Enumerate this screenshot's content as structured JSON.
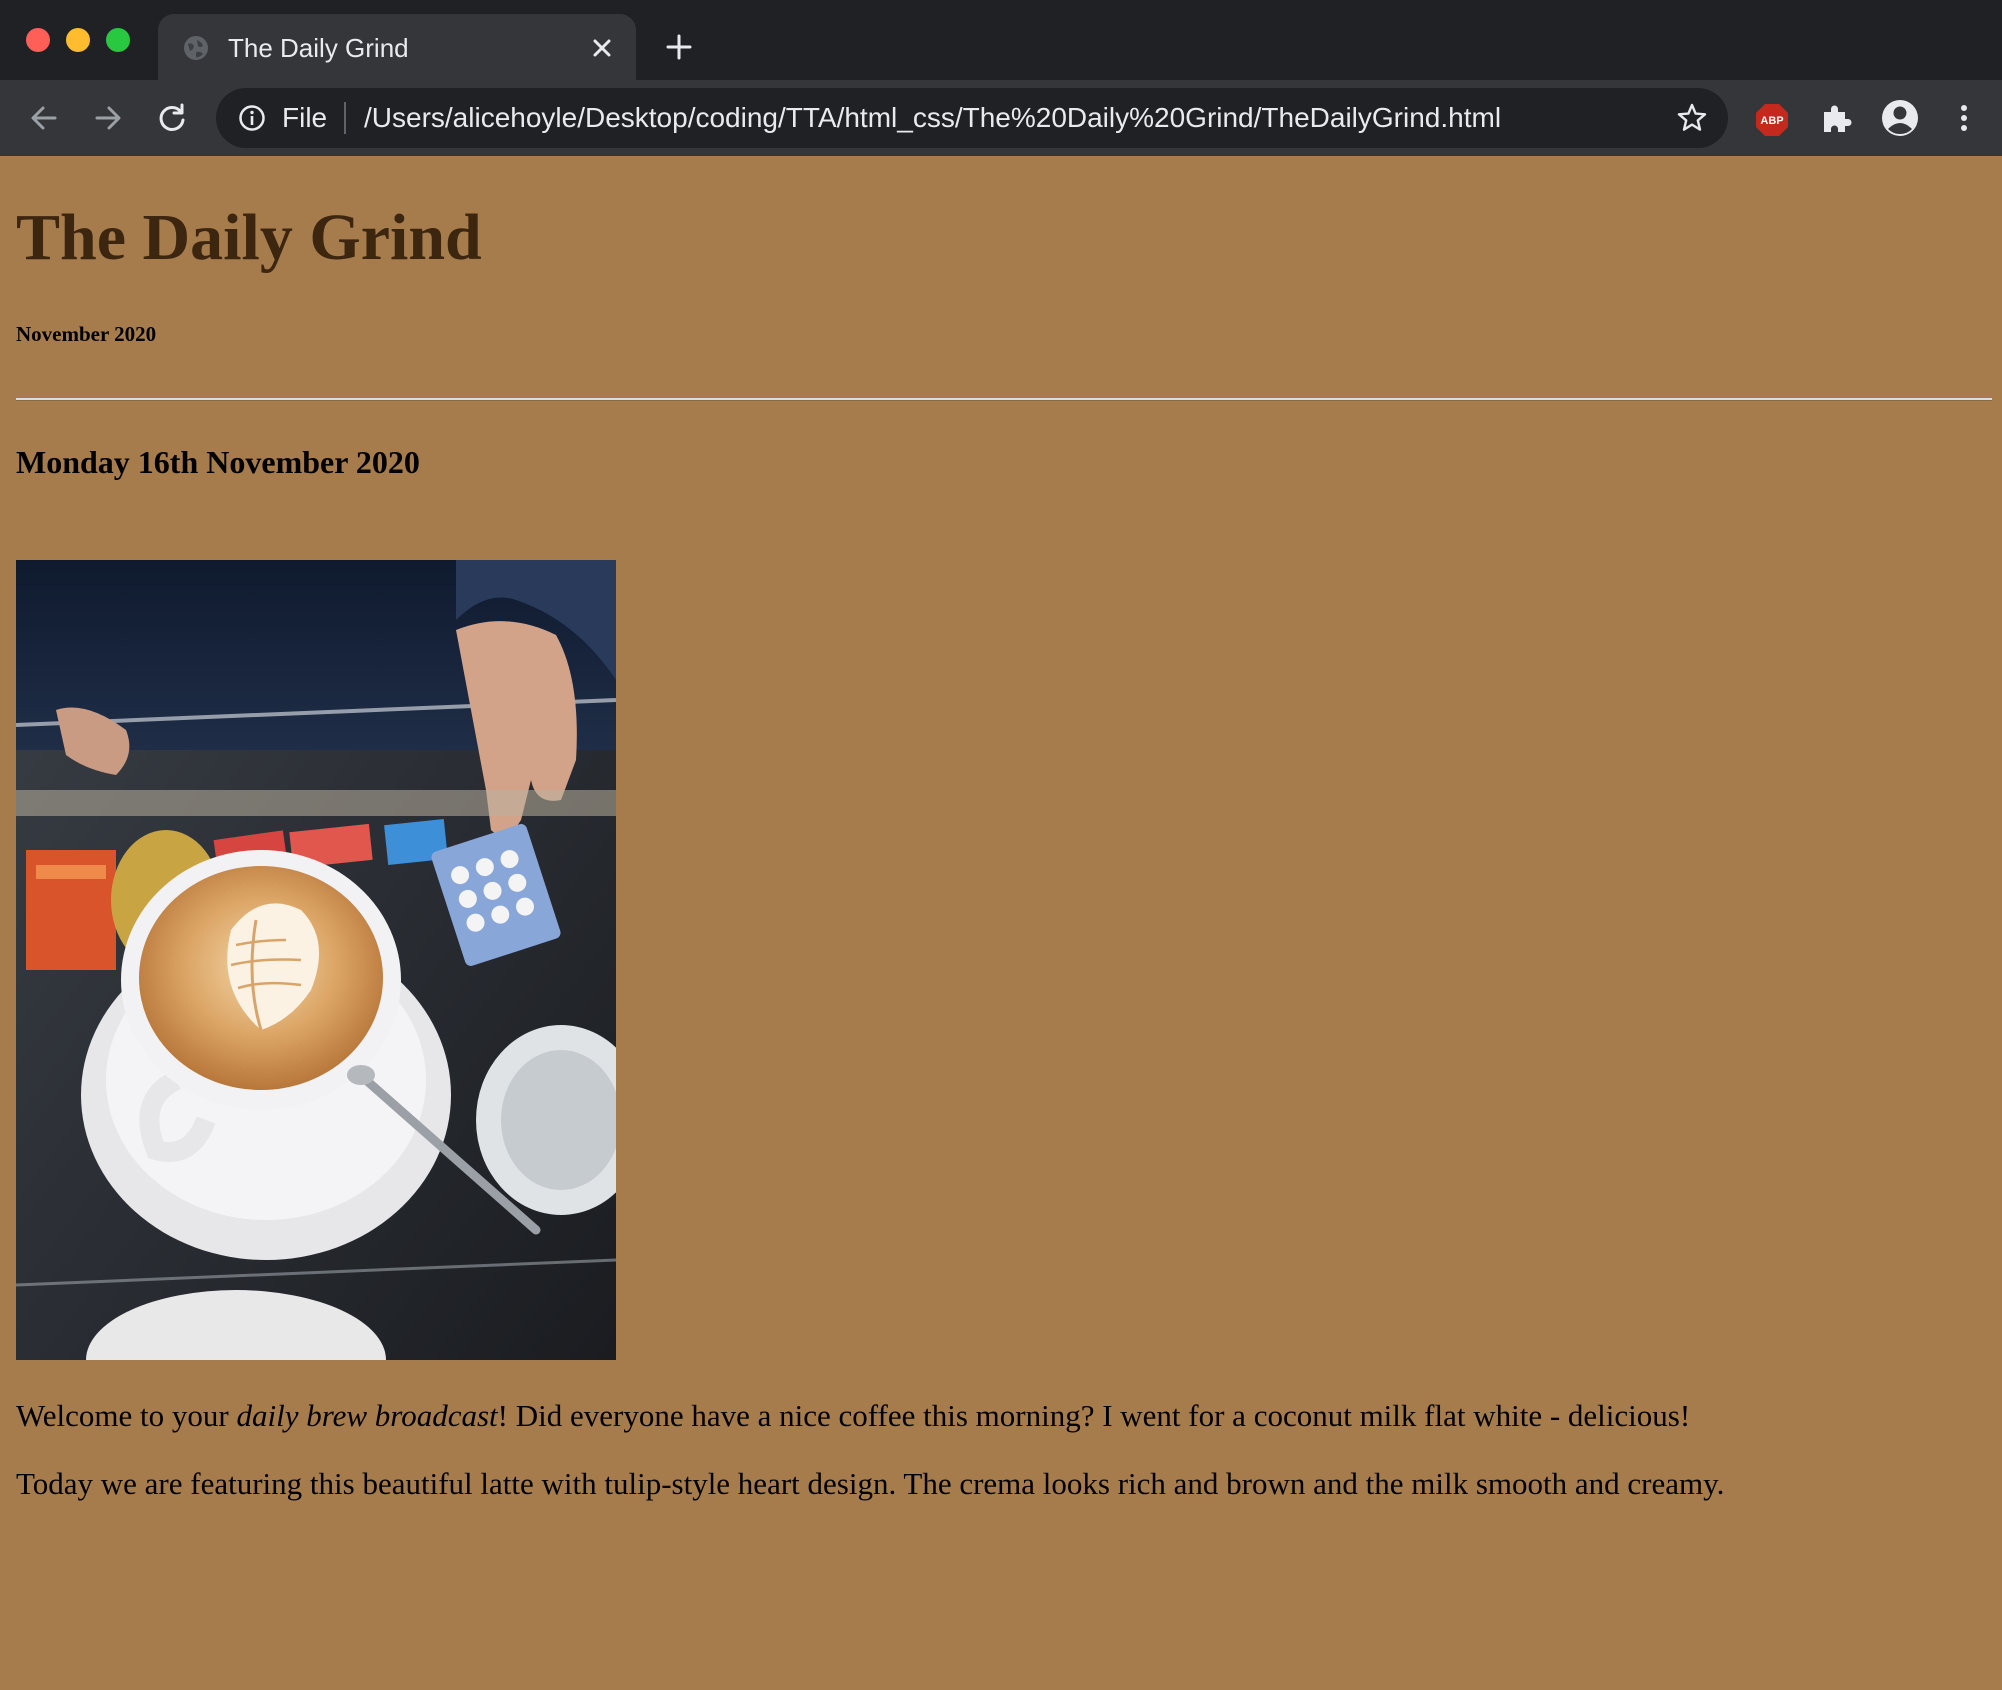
{
  "browser": {
    "tab_title": "The Daily Grind",
    "scheme_label": "File",
    "url": "/Users/alicehoyle/Desktop/coding/TTA/html_css/The%20Daily%20Grind/TheDailyGrind.html",
    "extension_badge": "ABP"
  },
  "page": {
    "title": "The Daily Grind",
    "issue_date": "November 2020",
    "post_date": "Monday 16th November 2020",
    "paragraph_1": {
      "before": "Welcome to your ",
      "emphasis": "daily brew broadcast",
      "after": "! Did everyone have a nice coffee this morning? I went for a coconut milk flat white - delicious!"
    },
    "paragraph_2": "Today we are featuring this beautiful latte with tulip-style heart design. The crema looks rich and brown and the milk smooth and creamy."
  },
  "colors": {
    "page_background": "#a67c4c",
    "title_color": "#3d2610",
    "chrome_dark": "#202124",
    "chrome_toolbar": "#35363a"
  }
}
